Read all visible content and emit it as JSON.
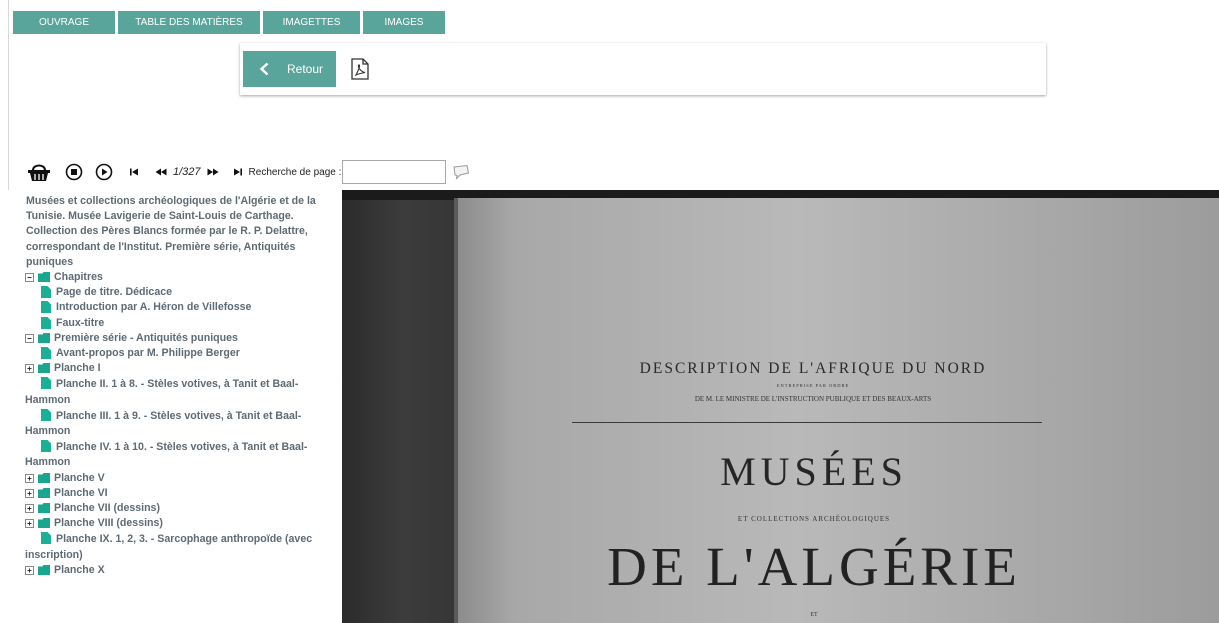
{
  "tabs": [
    {
      "label": "OUVRAGE"
    },
    {
      "label": "TABLE DES MATIÈRES"
    },
    {
      "label": "IMAGETTES"
    },
    {
      "label": "IMAGES"
    }
  ],
  "toolbar": {
    "back_label": "Retour",
    "pdf_icon": "pdf-icon"
  },
  "viewer": {
    "icons": [
      "basket-icon",
      "stop-icon",
      "play-icon",
      "first-page-icon",
      "prev-page-icon",
      "next-page-icon",
      "last-page-icon",
      "speech-bubble-icon"
    ],
    "page_indicator": "1/327",
    "search_label": "Recherche de page :",
    "search_value": "",
    "search_placeholder": ""
  },
  "toc": {
    "title": "Musées et collections archéologiques de l'Algérie et de la Tunisie. Musée Lavigerie de Saint-Louis de Carthage. Collection des Pères Blancs formée par le R. P. Delattre, correspondant de l'Institut. Première série, Antiquités puniques",
    "items": [
      {
        "label": "Chapitres"
      },
      {
        "label": "Page de titre. Dédicace"
      },
      {
        "label": "Introduction par A. Héron de Villefosse"
      },
      {
        "label": "Faux-titre"
      },
      {
        "label": "Première série - Antiquités puniques"
      },
      {
        "label": "Avant-propos par M. Philippe Berger"
      },
      {
        "label": "Planche I"
      },
      {
        "label": "Planche II. 1 à 8. - Stèles votives, à Tanit et Baal-Hammon"
      },
      {
        "label": "Planche III. 1 à 9. - Stèles votives, à Tanit et Baal-Hammon"
      },
      {
        "label": "Planche IV. 1 à 10. - Stèles votives, à Tanit et Baal-Hammon"
      },
      {
        "label": "Planche V"
      },
      {
        "label": "Planche VI"
      },
      {
        "label": "Planche VII (dessins)"
      },
      {
        "label": "Planche VIII (dessins)"
      },
      {
        "label": "Planche IX. 1, 2, 3. - Sarcophage anthropoïde (avec inscription)"
      },
      {
        "label": "Planche X"
      }
    ]
  },
  "scan": {
    "header_line1": "DESCRIPTION DE L'AFRIQUE DU NORD",
    "header_line2": "ENTREPRISE PAR ORDRE",
    "header_line3": "DE M. LE MINISTRE DE L'INSTRUCTION PUBLIQUE ET DES BEAUX-ARTS",
    "title_main": "MUSÉES",
    "title_sub": "ET COLLECTIONS ARCHÉOLOGIQUES",
    "title_big": "DE L'ALGÉRIE",
    "title_et": "ET"
  },
  "colors": {
    "accent": "#5aa59b",
    "toc_text": "#5e6a74",
    "folder": "#1aa58f",
    "doc": "#19b095"
  }
}
